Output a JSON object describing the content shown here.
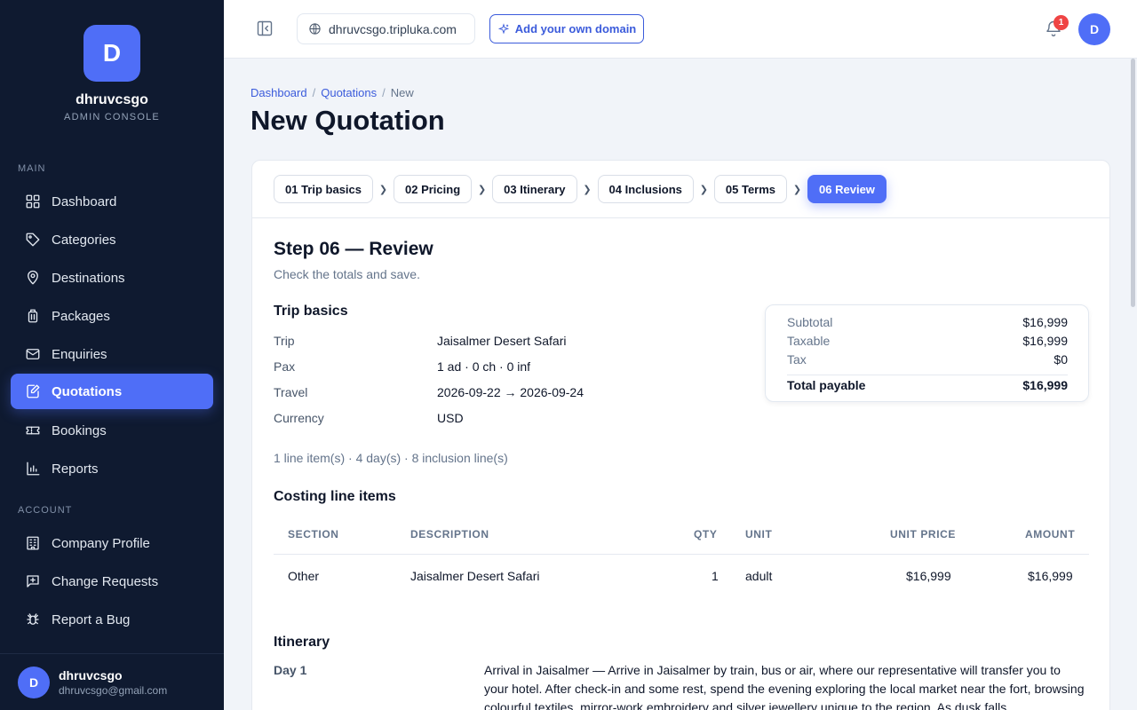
{
  "brand": {
    "initial": "D",
    "name": "dhruvcsgo",
    "subtitle": "ADMIN CONSOLE"
  },
  "sidebar": {
    "main_heading": "MAIN",
    "main_items": [
      {
        "label": "Dashboard",
        "icon": "grid-icon"
      },
      {
        "label": "Categories",
        "icon": "tag-icon"
      },
      {
        "label": "Destinations",
        "icon": "map-pin-icon"
      },
      {
        "label": "Packages",
        "icon": "luggage-icon"
      },
      {
        "label": "Enquiries",
        "icon": "mail-icon"
      },
      {
        "label": "Quotations",
        "icon": "edit-document-icon",
        "active": true
      },
      {
        "label": "Bookings",
        "icon": "ticket-icon"
      },
      {
        "label": "Reports",
        "icon": "bar-chart-icon"
      }
    ],
    "account_heading": "ACCOUNT",
    "account_items": [
      {
        "label": "Company Profile",
        "icon": "building-icon"
      },
      {
        "label": "Change Requests",
        "icon": "message-plus-icon"
      },
      {
        "label": "Report a Bug",
        "icon": "bug-icon"
      }
    ],
    "user": {
      "initial": "D",
      "name": "dhruvcsgo",
      "email": "dhruvcsgo@gmail.com"
    }
  },
  "topbar": {
    "domain": "dhruvcsgo.tripluka.com",
    "add_domain": "Add your own domain",
    "notifications": "1",
    "avatar_initial": "D"
  },
  "breadcrumb": {
    "dashboard": "Dashboard",
    "quotations": "Quotations",
    "current": "New",
    "sep": "/"
  },
  "page_title": "New Quotation",
  "steps": [
    "01 Trip basics",
    "02 Pricing",
    "03 Itinerary",
    "04 Inclusions",
    "05 Terms",
    "06 Review"
  ],
  "review": {
    "title": "Step 06 — Review",
    "subtitle": "Check the totals and save.",
    "trip_basics_title": "Trip basics",
    "fields": [
      {
        "label": "Trip",
        "value": "Jaisalmer Desert Safari"
      },
      {
        "label": "Pax",
        "value": "1 ad · 0 ch · 0 inf"
      },
      {
        "label": "Travel",
        "value": "2026-09-22 → 2026-09-24"
      },
      {
        "label": "Currency",
        "value": "USD"
      }
    ],
    "totals": {
      "subtotal_label": "Subtotal",
      "subtotal": "$16,999",
      "taxable_label": "Taxable",
      "taxable": "$16,999",
      "tax_label": "Tax",
      "tax": "$0",
      "total_label": "Total payable",
      "total": "$16,999"
    },
    "summary": "1 line item(s) · 4 day(s) · 8 inclusion line(s)",
    "costing_title": "Costing line items",
    "columns": [
      "SECTION",
      "DESCRIPTION",
      "QTY",
      "UNIT",
      "UNIT PRICE",
      "AMOUNT"
    ],
    "rows": [
      {
        "section": "Other",
        "description": "Jaisalmer Desert Safari",
        "qty": "1",
        "unit": "adult",
        "unit_price": "$16,999",
        "amount": "$16,999"
      }
    ],
    "itinerary_title": "Itinerary",
    "day_label": "Day 1",
    "day_text": "Arrival in Jaisalmer — Arrive in Jaisalmer by train, bus or air, where our representative will transfer you to your hotel. After check-in and some rest, spend the evening exploring the local market near the fort, browsing colourful textiles, mirror-work embroidery and silver jewellery unique to the region. As dusk falls"
  },
  "colors": {
    "accent": "#4f6ef7",
    "sidebar_bg": "#0f1a30",
    "badge": "#ef4444"
  }
}
